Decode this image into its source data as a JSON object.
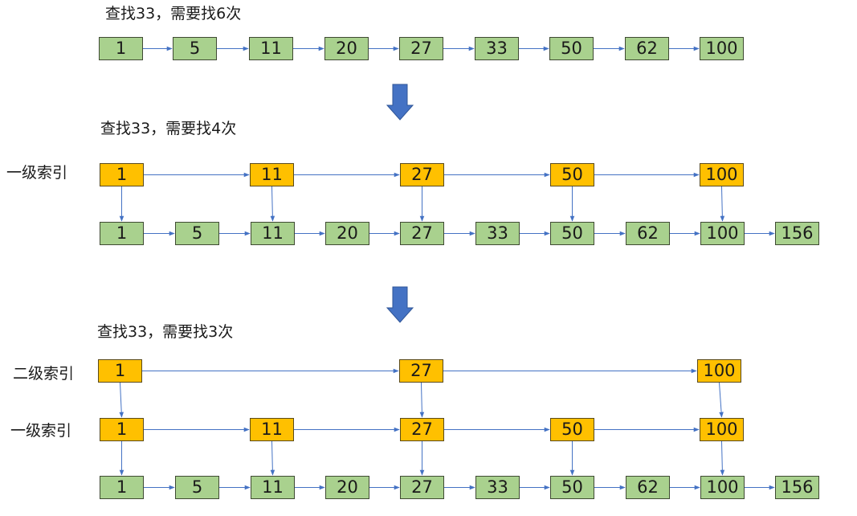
{
  "colors": {
    "base_node": "#a9d18e",
    "index_node": "#ffc000",
    "link_arrow": "#4472c4",
    "step_arrow": "#4472c4"
  },
  "sections": [
    {
      "caption": "查找33，需要找6次",
      "rows": [
        {
          "label": "",
          "kind": "base",
          "values": [
            "1",
            "5",
            "11",
            "20",
            "27",
            "33",
            "50",
            "62",
            "100"
          ]
        }
      ]
    },
    {
      "caption": "查找33，需要找4次",
      "rows": [
        {
          "label": "一级索引",
          "kind": "index",
          "values": [
            "1",
            "11",
            "27",
            "50",
            "100"
          ]
        },
        {
          "label": "",
          "kind": "base",
          "values": [
            "1",
            "5",
            "11",
            "20",
            "27",
            "33",
            "50",
            "62",
            "100",
            "156"
          ]
        }
      ]
    },
    {
      "caption": "查找33，需要找3次",
      "rows": [
        {
          "label": "二级索引",
          "kind": "index",
          "values": [
            "1",
            "27",
            "100"
          ]
        },
        {
          "label": "一级索引",
          "kind": "index",
          "values": [
            "1",
            "11",
            "27",
            "50",
            "100"
          ]
        },
        {
          "label": "",
          "kind": "base",
          "values": [
            "1",
            "5",
            "11",
            "20",
            "27",
            "33",
            "50",
            "62",
            "100",
            "156"
          ]
        }
      ]
    }
  ]
}
